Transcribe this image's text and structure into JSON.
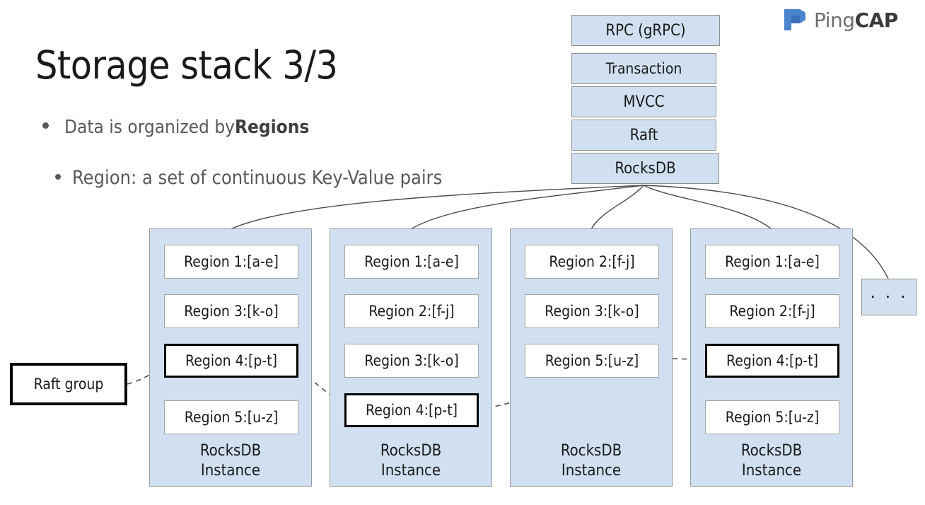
{
  "slide": {
    "title": "Storage stack 3/3",
    "bullets": [
      {
        "text_before": "Data is organized by ",
        "emphasis": "Regions",
        "text_after": ""
      },
      {
        "text_before": "Region: a set of continuous Key-Value pairs",
        "emphasis": "",
        "text_after": ""
      }
    ]
  },
  "brand": {
    "name_light": "Ping",
    "name_bold": "CAP",
    "logo_icon": "pingcap-flag-icon",
    "logo_color_dark": "#3c6fb8",
    "logo_color_light": "#4a84cc"
  },
  "colors": {
    "box_fill": "#d0e0f0",
    "box_border": "#8e8e8e",
    "region_fill": "#ffffff",
    "region_border": "#a6a6a6",
    "highlight_border": "#000000",
    "connector": "#4a4a4a",
    "text": "#1a1a1a",
    "bullet_text": "#595959"
  },
  "stack": {
    "layers": [
      {
        "label": "RPC (gRPC)"
      },
      {
        "label": "Transaction"
      },
      {
        "label": "MVCC"
      },
      {
        "label": "Raft"
      },
      {
        "label": "RocksDB"
      }
    ]
  },
  "instances": [
    {
      "footer_line1": "RocksDB",
      "footer_line2": "Instance",
      "regions": [
        {
          "label": "Region 1:[a-e]",
          "highlighted": false
        },
        {
          "label": "Region 3:[k-o]",
          "highlighted": false
        },
        {
          "label": "Region 4:[p-t]",
          "highlighted": true
        },
        {
          "label": "Region 5:[u-z]",
          "highlighted": false
        }
      ]
    },
    {
      "footer_line1": "RocksDB",
      "footer_line2": "Instance",
      "regions": [
        {
          "label": "Region 1:[a-e]",
          "highlighted": false
        },
        {
          "label": "Region 2:[f-j]",
          "highlighted": false
        },
        {
          "label": "Region 3:[k-o]",
          "highlighted": false
        },
        {
          "label": "Region 4:[p-t]",
          "highlighted": true
        }
      ]
    },
    {
      "footer_line1": "RocksDB",
      "footer_line2": "Instance",
      "regions": [
        {
          "label": "Region 2:[f-j]",
          "highlighted": false
        },
        {
          "label": "Region 3:[k-o]",
          "highlighted": false
        },
        {
          "label": "Region 5:[u-z]",
          "highlighted": false
        }
      ]
    },
    {
      "footer_line1": "RocksDB",
      "footer_line2": "Instance",
      "regions": [
        {
          "label": "Region 1:[a-e]",
          "highlighted": false
        },
        {
          "label": "Region 2:[f-j]",
          "highlighted": false
        },
        {
          "label": "Region 4:[p-t]",
          "highlighted": true
        },
        {
          "label": "Region 5:[u-z]",
          "highlighted": false
        }
      ]
    }
  ],
  "callouts": {
    "raft_group_label": "Raft group",
    "ellipsis_label": "· · ·"
  }
}
